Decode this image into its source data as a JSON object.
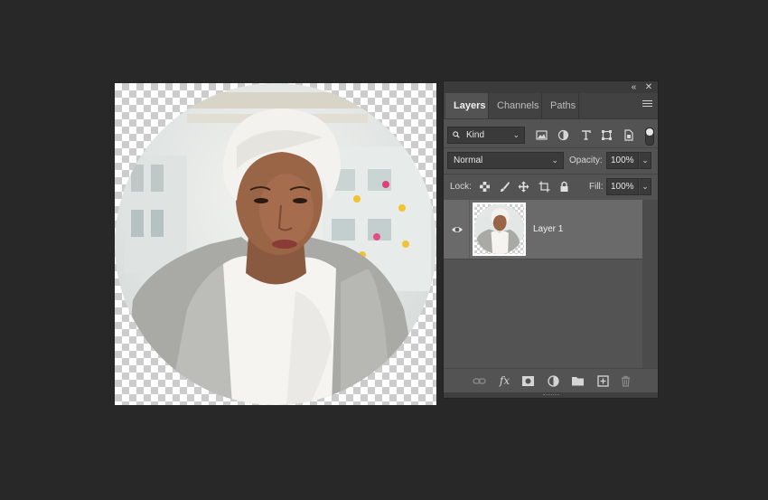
{
  "panel": {
    "collapse_glyph": "«",
    "close_glyph": "✕",
    "tabs": [
      {
        "label": "Layers",
        "active": true
      },
      {
        "label": "Channels",
        "active": false
      },
      {
        "label": "Paths",
        "active": false
      }
    ],
    "filter": {
      "kind_label": "Kind",
      "icons": [
        "pixel-layer-filter-icon",
        "adjustment-layer-filter-icon",
        "type-layer-filter-icon",
        "shape-layer-filter-icon",
        "smart-object-filter-icon"
      ]
    },
    "blend_mode": "Normal",
    "opacity_label": "Opacity:",
    "opacity_value": "100%",
    "lock_label": "Lock:",
    "fill_label": "Fill:",
    "fill_value": "100%",
    "layers": [
      {
        "name": "Layer 1",
        "visible": true,
        "selected": true
      }
    ],
    "bottom_icons": [
      "link-icon",
      "fx-icon",
      "mask-icon",
      "adjustment-icon",
      "folder-icon",
      "new-layer-icon",
      "trash-icon"
    ],
    "fx_label": "fx"
  },
  "canvas": {
    "background": "transparent-checkerboard",
    "content": "circular-cropped-portrait"
  }
}
